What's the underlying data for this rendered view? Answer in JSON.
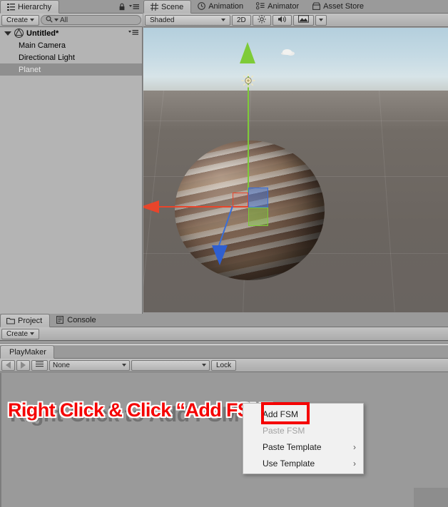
{
  "hierarchy": {
    "tab_label": "Hierarchy",
    "tab_icon": "hierarchy-icon",
    "lock_icon": "lock-icon",
    "menu_icon": "options-menu-icon",
    "create_label": "Create",
    "search_placeholder": "All",
    "search_value": "All",
    "search_icon": "search-icon",
    "scene_name": "Untitled*",
    "scene_menu_icon": "options-menu-icon",
    "items": [
      {
        "label": "Main Camera",
        "selected": false
      },
      {
        "label": "Directional Light",
        "selected": false
      },
      {
        "label": "Planet",
        "selected": true
      }
    ]
  },
  "scene": {
    "tabs": [
      {
        "label": "Scene",
        "icon": "grid-icon",
        "active": true
      },
      {
        "label": "Animation",
        "icon": "clock-icon",
        "active": false
      },
      {
        "label": "Animator",
        "icon": "nodes-icon",
        "active": false
      },
      {
        "label": "Asset Store",
        "icon": "store-icon",
        "active": false
      }
    ],
    "toolbar": {
      "draw_mode": "Shaded",
      "twod_label": "2D",
      "lighting_icon": "sun-icon",
      "audio_icon": "speaker-icon",
      "gizmos_icon": "image-icon"
    },
    "objects": {
      "planet_name": "Planet",
      "gizmo": "move-gizmo",
      "light_gizmo": "light-gizmo",
      "cloud": "cloud-sprite"
    }
  },
  "project": {
    "tabs": [
      {
        "label": "Project",
        "icon": "folder-icon",
        "active": true
      },
      {
        "label": "Console",
        "icon": "console-icon",
        "active": false
      }
    ],
    "create_label": "Create"
  },
  "playmaker": {
    "tab_label": "PlayMaker",
    "toolbar": {
      "back_icon": "arrow-left-icon",
      "forward_icon": "arrow-right-icon",
      "menu_icon": "hamburger-icon",
      "fsm_select": "None",
      "state_select": "",
      "lock_label": "Lock"
    },
    "watermark": "Right-Click to Add FSM"
  },
  "annotation": {
    "text": "Right Click & Click “Add FSN”",
    "color": "#f50000",
    "outline_color": "#ffffff"
  },
  "context_menu": {
    "items": [
      {
        "label": "Add FSM",
        "disabled": false,
        "submenu": false,
        "highlighted": true
      },
      {
        "label": "Paste FSM",
        "disabled": true,
        "submenu": false,
        "highlighted": false
      },
      {
        "label": "Paste Template",
        "disabled": false,
        "submenu": true,
        "highlighted": false
      },
      {
        "label": "Use Template",
        "disabled": false,
        "submenu": true,
        "highlighted": false
      }
    ],
    "submenu_arrow": "›",
    "highlight_color": "#f50000"
  }
}
